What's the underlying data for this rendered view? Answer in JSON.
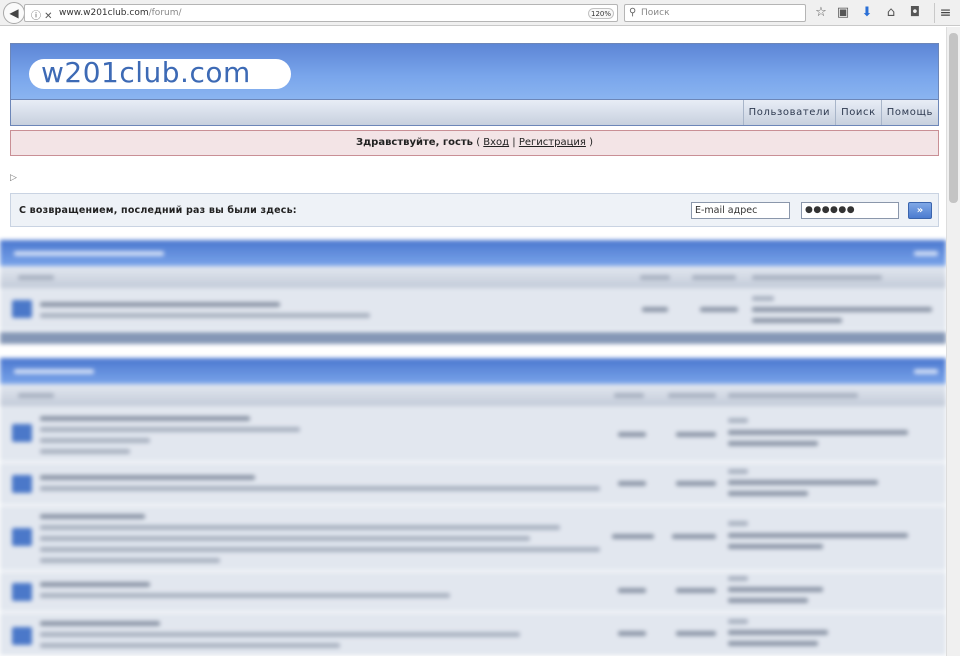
{
  "browser": {
    "url_domain": "www.w201club.com",
    "url_path": "/forum/",
    "zoom": "120%",
    "search_placeholder": "Поиск"
  },
  "site": {
    "logo_text": "w201club.com",
    "nav": [
      "Пользователи",
      "Поиск",
      "Помощь"
    ]
  },
  "welcome": {
    "greeting": "Здравствуйте, гость",
    "open_paren": "(",
    "login_link": "Вход",
    "separator": "|",
    "register_link": "Регистрация",
    "close_paren": ")"
  },
  "login": {
    "message": "С возвращением, последний раз вы были здесь:",
    "email_placeholder": "E-mail адрес",
    "password_value": "●●●●●●",
    "submit_label": "»"
  },
  "colors": {
    "header_blue": "#5d86d6",
    "welcome_bg": "#f3e4e6",
    "row_bg": "#e2e7ef"
  }
}
